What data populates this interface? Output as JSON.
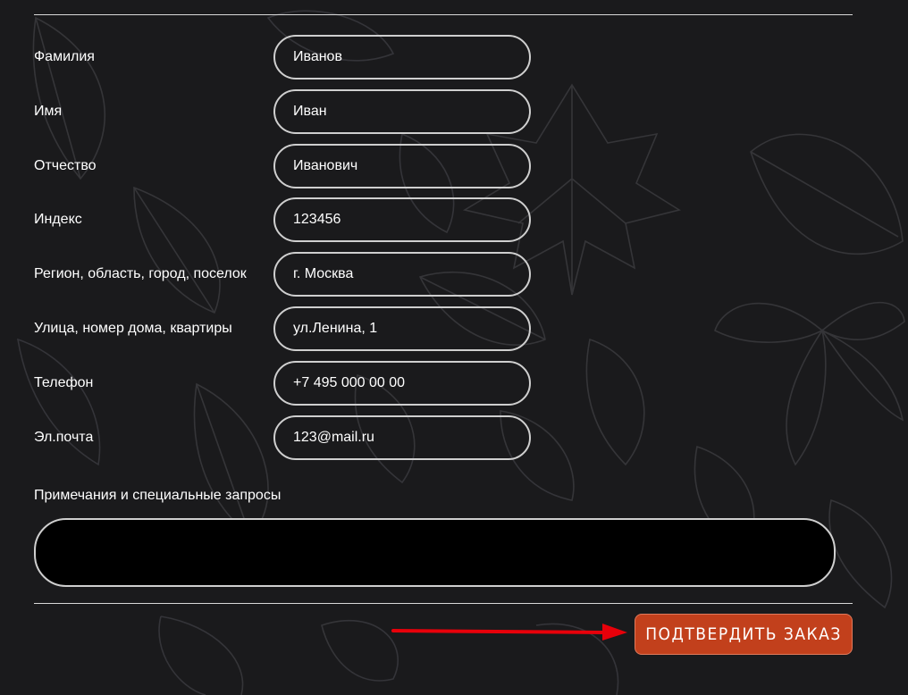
{
  "form": {
    "fields": [
      {
        "label": "Фамилия",
        "value": "Иванов"
      },
      {
        "label": "Имя",
        "value": "Иван"
      },
      {
        "label": "Отчество",
        "value": "Иванович"
      },
      {
        "label": "Индекс",
        "value": "123456"
      },
      {
        "label": "Регион, область, город, поселок",
        "value": "г. Москва"
      },
      {
        "label": "Улица, номер дома, квартиры",
        "value": "ул.Ленина, 1"
      },
      {
        "label": "Телефон",
        "value": "+7 495 000 00 00"
      },
      {
        "label": "Эл.почта",
        "value": "123@mail.ru"
      }
    ],
    "notes_label": "Примечания и специальные запросы",
    "notes_value": "",
    "submit_label": "ПОДТВЕРДИТЬ ЗАКАЗ"
  },
  "colors": {
    "background": "#1a1a1c",
    "accent_button": "#c2401c",
    "arrow": "#e8000a",
    "field_border": "#cfcfcf"
  }
}
